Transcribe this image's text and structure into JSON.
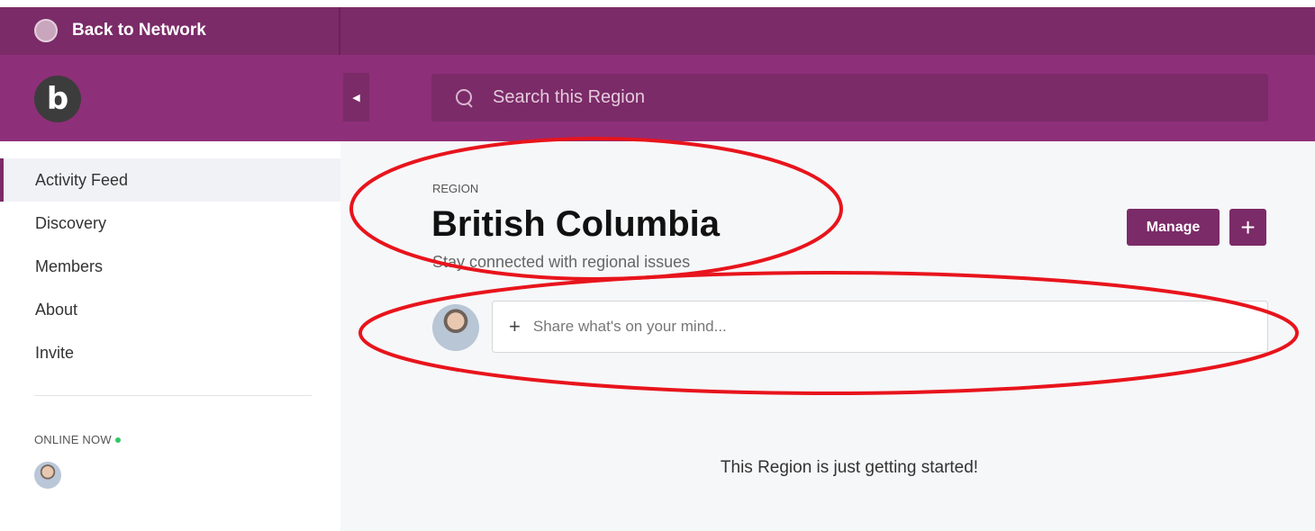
{
  "topbar": {
    "back_label": "Back to Network"
  },
  "brand": {
    "logo_letter": "b"
  },
  "search": {
    "placeholder": "Search this Region"
  },
  "sidebar": {
    "items": [
      {
        "label": "Activity Feed",
        "active": true
      },
      {
        "label": "Discovery"
      },
      {
        "label": "Members"
      },
      {
        "label": "About"
      },
      {
        "label": "Invite"
      }
    ],
    "online_label": "ONLINE NOW"
  },
  "region": {
    "kicker": "REGION",
    "title": "British Columbia",
    "subtitle": "Stay connected with regional issues",
    "manage_label": "Manage",
    "add_label": "+"
  },
  "composer": {
    "plus": "+",
    "placeholder": "Share what's on your mind..."
  },
  "feed": {
    "empty_message": "This Region is just getting started!"
  },
  "colors": {
    "brand_dark": "#7b2b68",
    "brand": "#8e2f79",
    "annotation": "#e8141c",
    "online": "#35c46a"
  },
  "icons": [
    "search-icon",
    "chevron-left-icon",
    "plus-icon",
    "online-dot-icon"
  ]
}
